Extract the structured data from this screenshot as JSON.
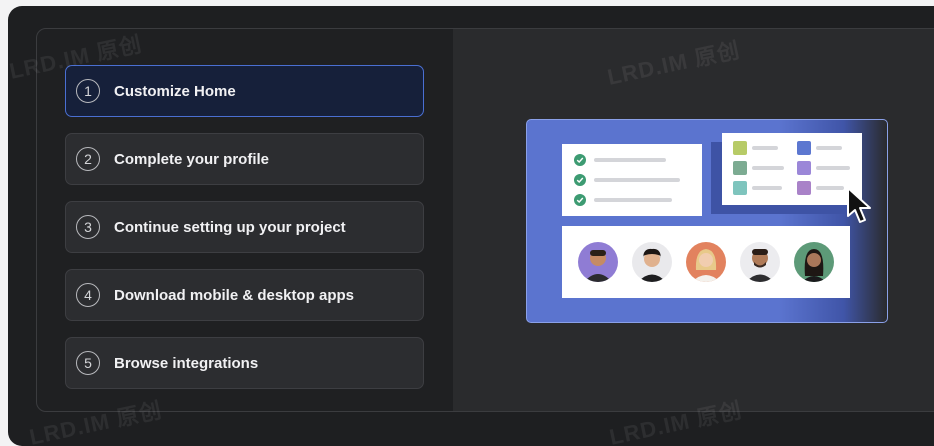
{
  "steps": [
    {
      "number": "1",
      "label": "Customize Home",
      "active": true
    },
    {
      "number": "2",
      "label": "Complete your profile",
      "active": false
    },
    {
      "number": "3",
      "label": "Continue setting up your project",
      "active": false
    },
    {
      "number": "4",
      "label": "Download mobile & desktop apps",
      "active": false
    },
    {
      "number": "5",
      "label": "Browse integrations",
      "active": false
    }
  ],
  "watermark": "LRD.IM 原创",
  "illustration": {
    "icon_names": [
      "checkmark-icon",
      "cursor-icon"
    ],
    "colors": {
      "background": "#5b74cf",
      "check": "#3d9b72",
      "squares": [
        "#b7cb67",
        "#7cab92",
        "#7ec4bd",
        "#5c77d0",
        "#9b87d8",
        "#a982c8"
      ]
    }
  }
}
